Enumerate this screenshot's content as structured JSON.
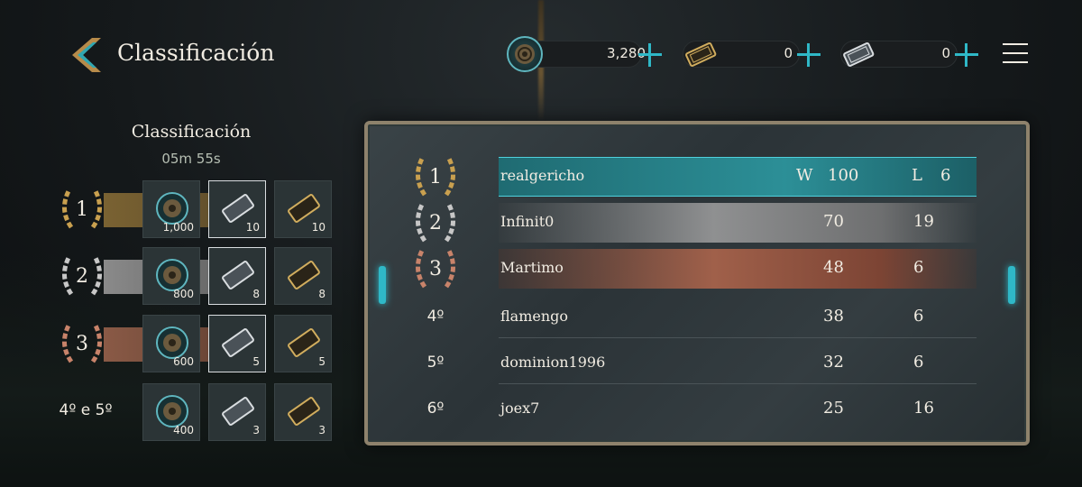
{
  "header": {
    "title": "Classificación",
    "currencies": [
      {
        "icon": "coin-icon",
        "value": "3,280"
      },
      {
        "icon": "gold-ticket-icon",
        "value": "0"
      },
      {
        "icon": "silver-ticket-icon",
        "value": "0"
      }
    ]
  },
  "rewards": {
    "title": "Classificación",
    "timer": "05m 55s",
    "tiers": [
      {
        "rank": "1",
        "coins": "1,000",
        "silver": "10",
        "gold": "10"
      },
      {
        "rank": "2",
        "coins": "800",
        "silver": "8",
        "gold": "8"
      },
      {
        "rank": "3",
        "coins": "600",
        "silver": "5",
        "gold": "5"
      },
      {
        "rank": "4º e 5º",
        "coins": "400",
        "silver": "3",
        "gold": "3"
      }
    ]
  },
  "leaderboard": {
    "win_header": "W",
    "loss_header": "L",
    "rows": [
      {
        "rank": "1",
        "name": "realgericho",
        "wins": "100",
        "losses": "6"
      },
      {
        "rank": "2",
        "name": "Infinit0",
        "wins": "70",
        "losses": "19"
      },
      {
        "rank": "3",
        "name": "Martimo",
        "wins": "48",
        "losses": "6"
      },
      {
        "rank": "4º",
        "name": "flamengo",
        "wins": "38",
        "losses": "6"
      },
      {
        "rank": "5º",
        "name": "dominion1996",
        "wins": "32",
        "losses": "6"
      },
      {
        "rank": "6º",
        "name": "joex7",
        "wins": "25",
        "losses": "16"
      }
    ]
  },
  "colors": {
    "gold": "#c9a04f",
    "silver": "#c7c7c7",
    "bronze": "#c8836a",
    "teal": "#2fb8c7"
  }
}
